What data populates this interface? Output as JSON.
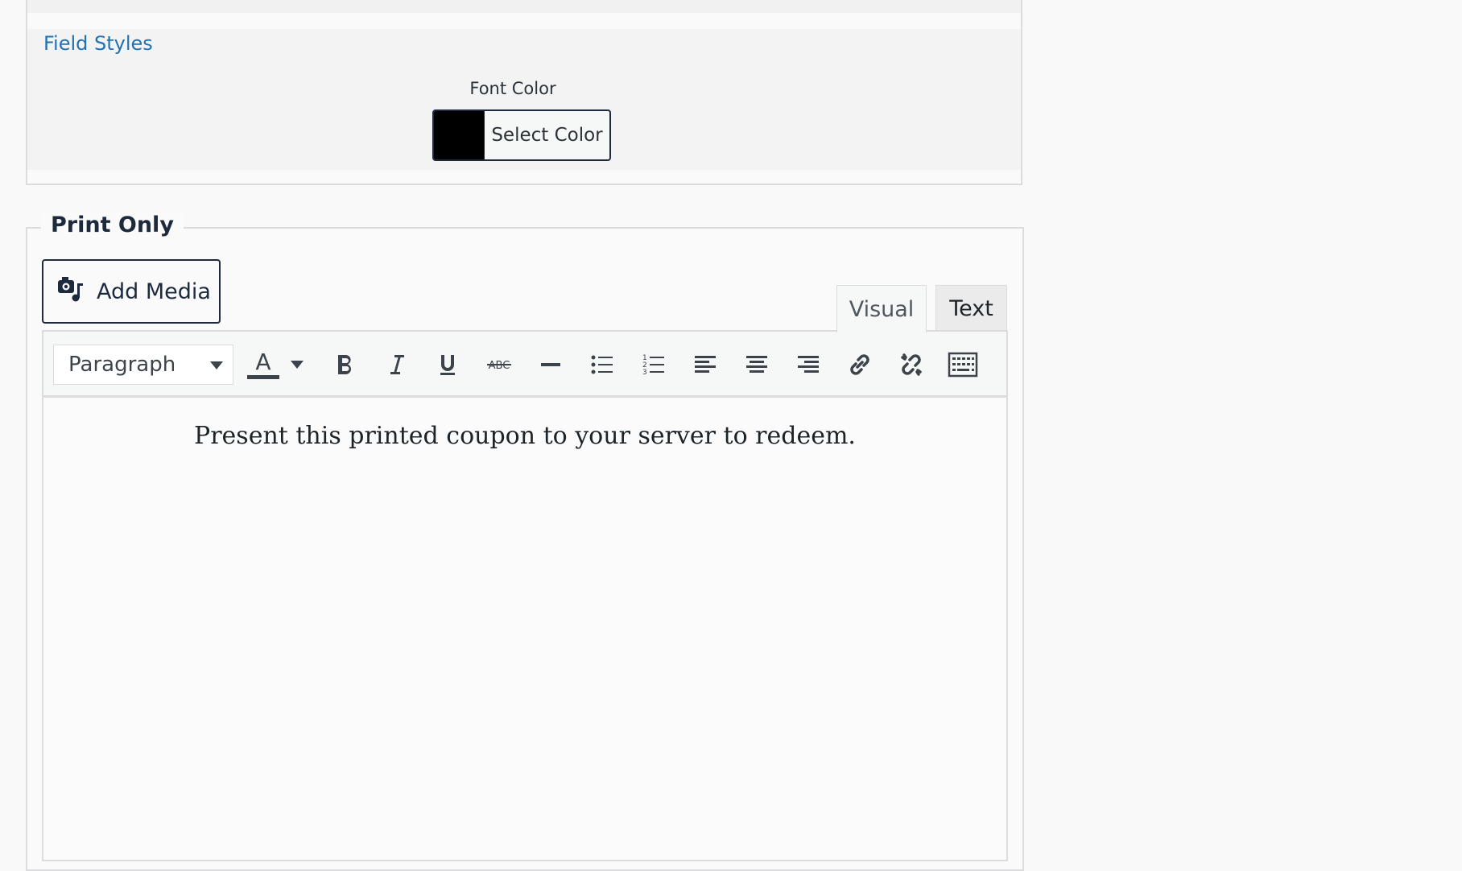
{
  "field_styles": {
    "link_label": "Field Styles",
    "font_color_label": "Font Color",
    "swatch_color": "#000000",
    "select_color_label": "Select Color"
  },
  "print_only": {
    "legend": "Print Only",
    "add_media_label": "Add Media",
    "tabs": [
      {
        "label": "Visual",
        "active": true
      },
      {
        "label": "Text",
        "active": false
      }
    ],
    "toolbar": {
      "format_value": "Paragraph",
      "text_color_glyph": "A",
      "icons": [
        "text-color-icon",
        "bold-icon",
        "italic-icon",
        "underline-icon",
        "strikethrough-icon",
        "horizontal-line-icon",
        "bullet-list-icon",
        "numbered-list-icon",
        "align-left-icon",
        "align-center-icon",
        "align-right-icon",
        "link-icon",
        "unlink-icon",
        "toolbar-toggle-icon"
      ]
    },
    "content": "Present this printed coupon to your server to redeem."
  }
}
